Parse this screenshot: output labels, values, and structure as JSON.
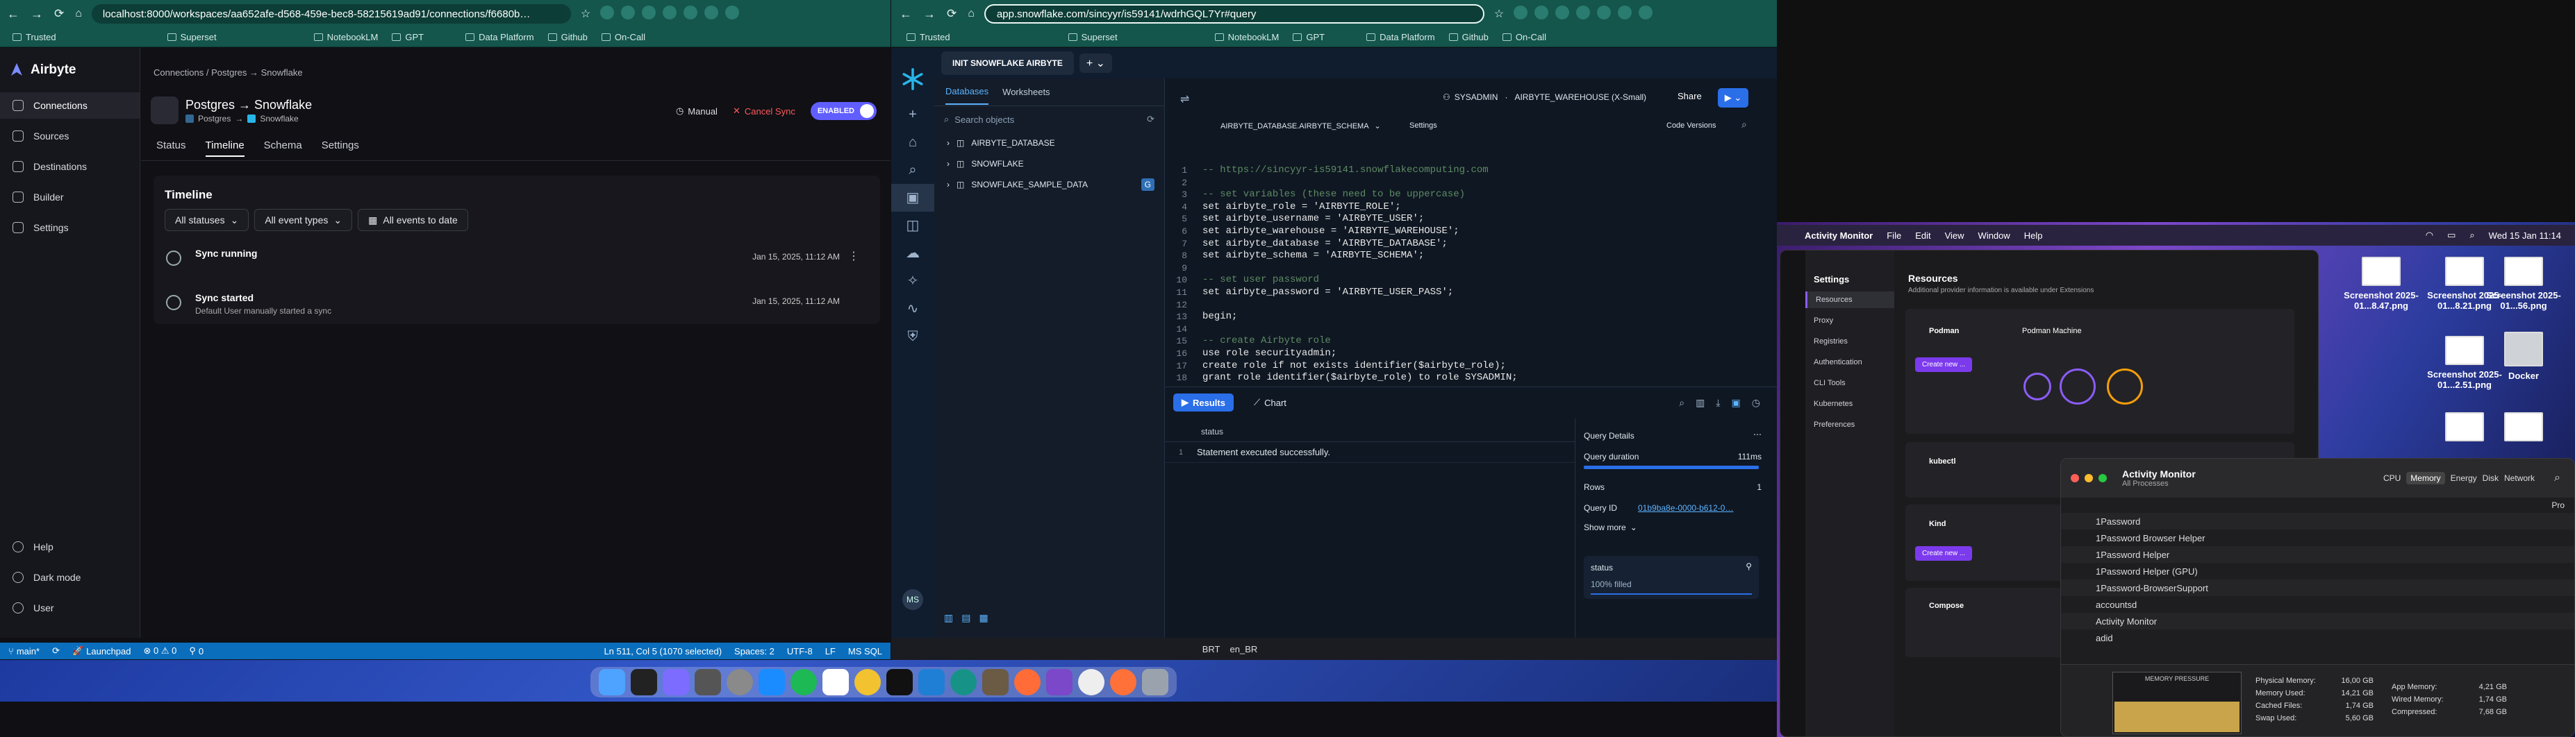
{
  "left_browser": {
    "url": "localhost:8000/workspaces/aa652afe-d568-459e-bec8-5821561​9ad91/connections/f6680b…",
    "bookmarks": [
      "Trusted",
      "Superset",
      "NotebookLM",
      "GPT",
      "Data Platform",
      "Github",
      "On-Call"
    ]
  },
  "airbyte": {
    "logo": "Airbyte",
    "nav": [
      "Connections",
      "Sources",
      "Destinations",
      "Builder",
      "Settings"
    ],
    "nav_bottom": [
      "Help",
      "Dark mode",
      "User"
    ],
    "breadcrumb": "Connections / Postgres → Snowflake",
    "title": "Postgres → Snowflake",
    "source": "Postgres",
    "destination": "Snowflake",
    "schedule": "Manual",
    "cancel": "Cancel Sync",
    "toggle": "ENABLED",
    "tabs": [
      "Status",
      "Timeline",
      "Schema",
      "Settings"
    ],
    "section_title": "Timeline",
    "filters": [
      "All statuses",
      "All event types",
      "All events to date"
    ],
    "events": [
      {
        "title": "Sync running",
        "subtitle": "",
        "time": "Jan 15, 2025, 11:12 AM"
      },
      {
        "title": "Sync started",
        "subtitle": "Default User manually started a sync",
        "time": "Jan 15, 2025, 11:12 AM"
      }
    ]
  },
  "vscode_status": {
    "branch": "main*",
    "launchpad": "Launchpad",
    "counts": "⊗ 0 ⚠ 0",
    "ports": "0",
    "position": "Ln 511, Col 5 (1070 selected)",
    "spaces": "Spaces: 2",
    "encoding": "UTF-8",
    "eol": "LF",
    "lang": "MS SQL"
  },
  "right_browser": {
    "url": "app.snowflake.com/sincyyr/is59141/wdrhGQL7Yr#query",
    "bookmarks": [
      "Trusted",
      "Superset",
      "NotebookLM",
      "GPT",
      "Data Platform",
      "Github",
      "On-Call"
    ]
  },
  "snowflake": {
    "worksheet_tab": "INIT SNOWFLAKE AIRBYTE",
    "tree_tabs": [
      "Databases",
      "Worksheets"
    ],
    "search_placeholder": "Search objects",
    "databases": [
      "AIRBYTE_DATABASE",
      "SNOWFLAKE",
      "SNOWFLAKE_SAMPLE_DATA"
    ],
    "role": "SYSADMIN",
    "warehouse": "AIRBYTE_WAREHOUSE (X-Small)",
    "share": "Share",
    "context": "AIRBYTE_DATABASE.AIRBYTE_SCHEMA",
    "settings": "Settings",
    "code_versions": "Code Versions",
    "code_lines": [
      {
        "n": "1",
        "t": "-- https://sincyyr-is59141.snowflakecomputing.com",
        "c": "c-cm"
      },
      {
        "n": "2",
        "t": "",
        "c": "c-id"
      },
      {
        "n": "3",
        "t": "-- set variables (these need to be uppercase)",
        "c": "c-cm"
      },
      {
        "n": "4",
        "t": "set airbyte_role = 'AIRBYTE_ROLE';",
        "c": "c-id"
      },
      {
        "n": "5",
        "t": "set airbyte_username = 'AIRBYTE_USER';",
        "c": "c-id"
      },
      {
        "n": "6",
        "t": "set airbyte_warehouse = 'AIRBYTE_WAREHOUSE';",
        "c": "c-id"
      },
      {
        "n": "7",
        "t": "set airbyte_database = 'AIRBYTE_DATABASE';",
        "c": "c-id"
      },
      {
        "n": "8",
        "t": "set airbyte_schema = 'AIRBYTE_SCHEMA';",
        "c": "c-id"
      },
      {
        "n": "9",
        "t": "",
        "c": "c-id"
      },
      {
        "n": "10",
        "t": "-- set user password",
        "c": "c-cm"
      },
      {
        "n": "11",
        "t": "set airbyte_password = 'AIRBYTE_USER_PASS';",
        "c": "c-id"
      },
      {
        "n": "12",
        "t": "",
        "c": "c-id"
      },
      {
        "n": "13",
        "t": "begin;",
        "c": "c-id"
      },
      {
        "n": "14",
        "t": "",
        "c": "c-id"
      },
      {
        "n": "15",
        "t": "-- create Airbyte role",
        "c": "c-cm"
      },
      {
        "n": "16",
        "t": "use role securityadmin;",
        "c": "c-id"
      },
      {
        "n": "17",
        "t": "create role if not exists identifier($airbyte_role);",
        "c": "c-id"
      },
      {
        "n": "18",
        "t": "grant role identifier($airbyte_role) to role SYSADMIN;",
        "c": "c-id"
      }
    ],
    "results_tab": "Results",
    "chart_tab": "Chart",
    "col_header": "status",
    "row_num": "1",
    "row_value": "Statement executed successfully.",
    "details_title": "Query Details",
    "query_duration_label": "Query duration",
    "query_duration": "111ms",
    "rows_label": "Rows",
    "rows": "1",
    "query_id_label": "Query ID",
    "query_id": "01b9ba8e-0000-b612-0…",
    "show_more": "Show more",
    "status_label": "status",
    "status_value": "100% filled",
    "user_initials": "MS"
  },
  "taskbar_left": {
    "lang1": "BRT",
    "lang2": "en_BR"
  },
  "mac_menubar": {
    "app": "Activity Monitor",
    "menus": [
      "File",
      "Edit",
      "View",
      "Window",
      "Help"
    ],
    "datetime": "Wed 15 Jan  11:14"
  },
  "podman": {
    "sidebar_title": "Settings",
    "items": [
      "Resources",
      "Proxy",
      "Registries",
      "Authentication",
      "CLI Tools",
      "Kubernetes",
      "Preferences"
    ],
    "main_title": "Resources",
    "main_sub": "Additional provider information is available under Extensions",
    "providers": [
      "Podman",
      "kubectl",
      "Kind",
      "Compose"
    ],
    "machine": "Podman Machine",
    "create_btn": "Create new ..."
  },
  "desktop_files": [
    {
      "name": "Screenshot 2025-01...8.47.png"
    },
    {
      "name": "Screenshot 2025-01...8.21.png"
    },
    {
      "name": "Screenshot 2025-01...56.png"
    },
    {
      "name": "Screenshot 2025-01...2.51.png"
    },
    {
      "name": "Docker"
    },
    {
      "name": ""
    },
    {
      "name": ""
    }
  ],
  "activity_monitor": {
    "title": "Activity Monitor",
    "subtitle": "All Processes",
    "tabs": [
      "CPU",
      "Memory",
      "Energy",
      "Disk",
      "Network"
    ],
    "col": "Pro",
    "processes": [
      "1Password",
      "1Password Browser Helper",
      "1Password Helper",
      "1Password Helper (GPU)",
      "1Password-BrowserSupport",
      "accountsd",
      "Activity Monitor",
      "adid"
    ],
    "pressure_label": "MEMORY PRESSURE",
    "stats_left": [
      {
        "k": "Physical Memory:",
        "v": "16,00 GB"
      },
      {
        "k": "Memory Used:",
        "v": "14,21 GB"
      },
      {
        "k": "Cached Files:",
        "v": "1,74 GB"
      },
      {
        "k": "Swap Used:",
        "v": "5,60 GB"
      }
    ],
    "stats_right": [
      {
        "k": "App Memory:",
        "v": "4,21 GB"
      },
      {
        "k": "Wired Memory:",
        "v": "1,74 GB"
      },
      {
        "k": "Compressed:",
        "v": "7,68 GB"
      }
    ]
  }
}
